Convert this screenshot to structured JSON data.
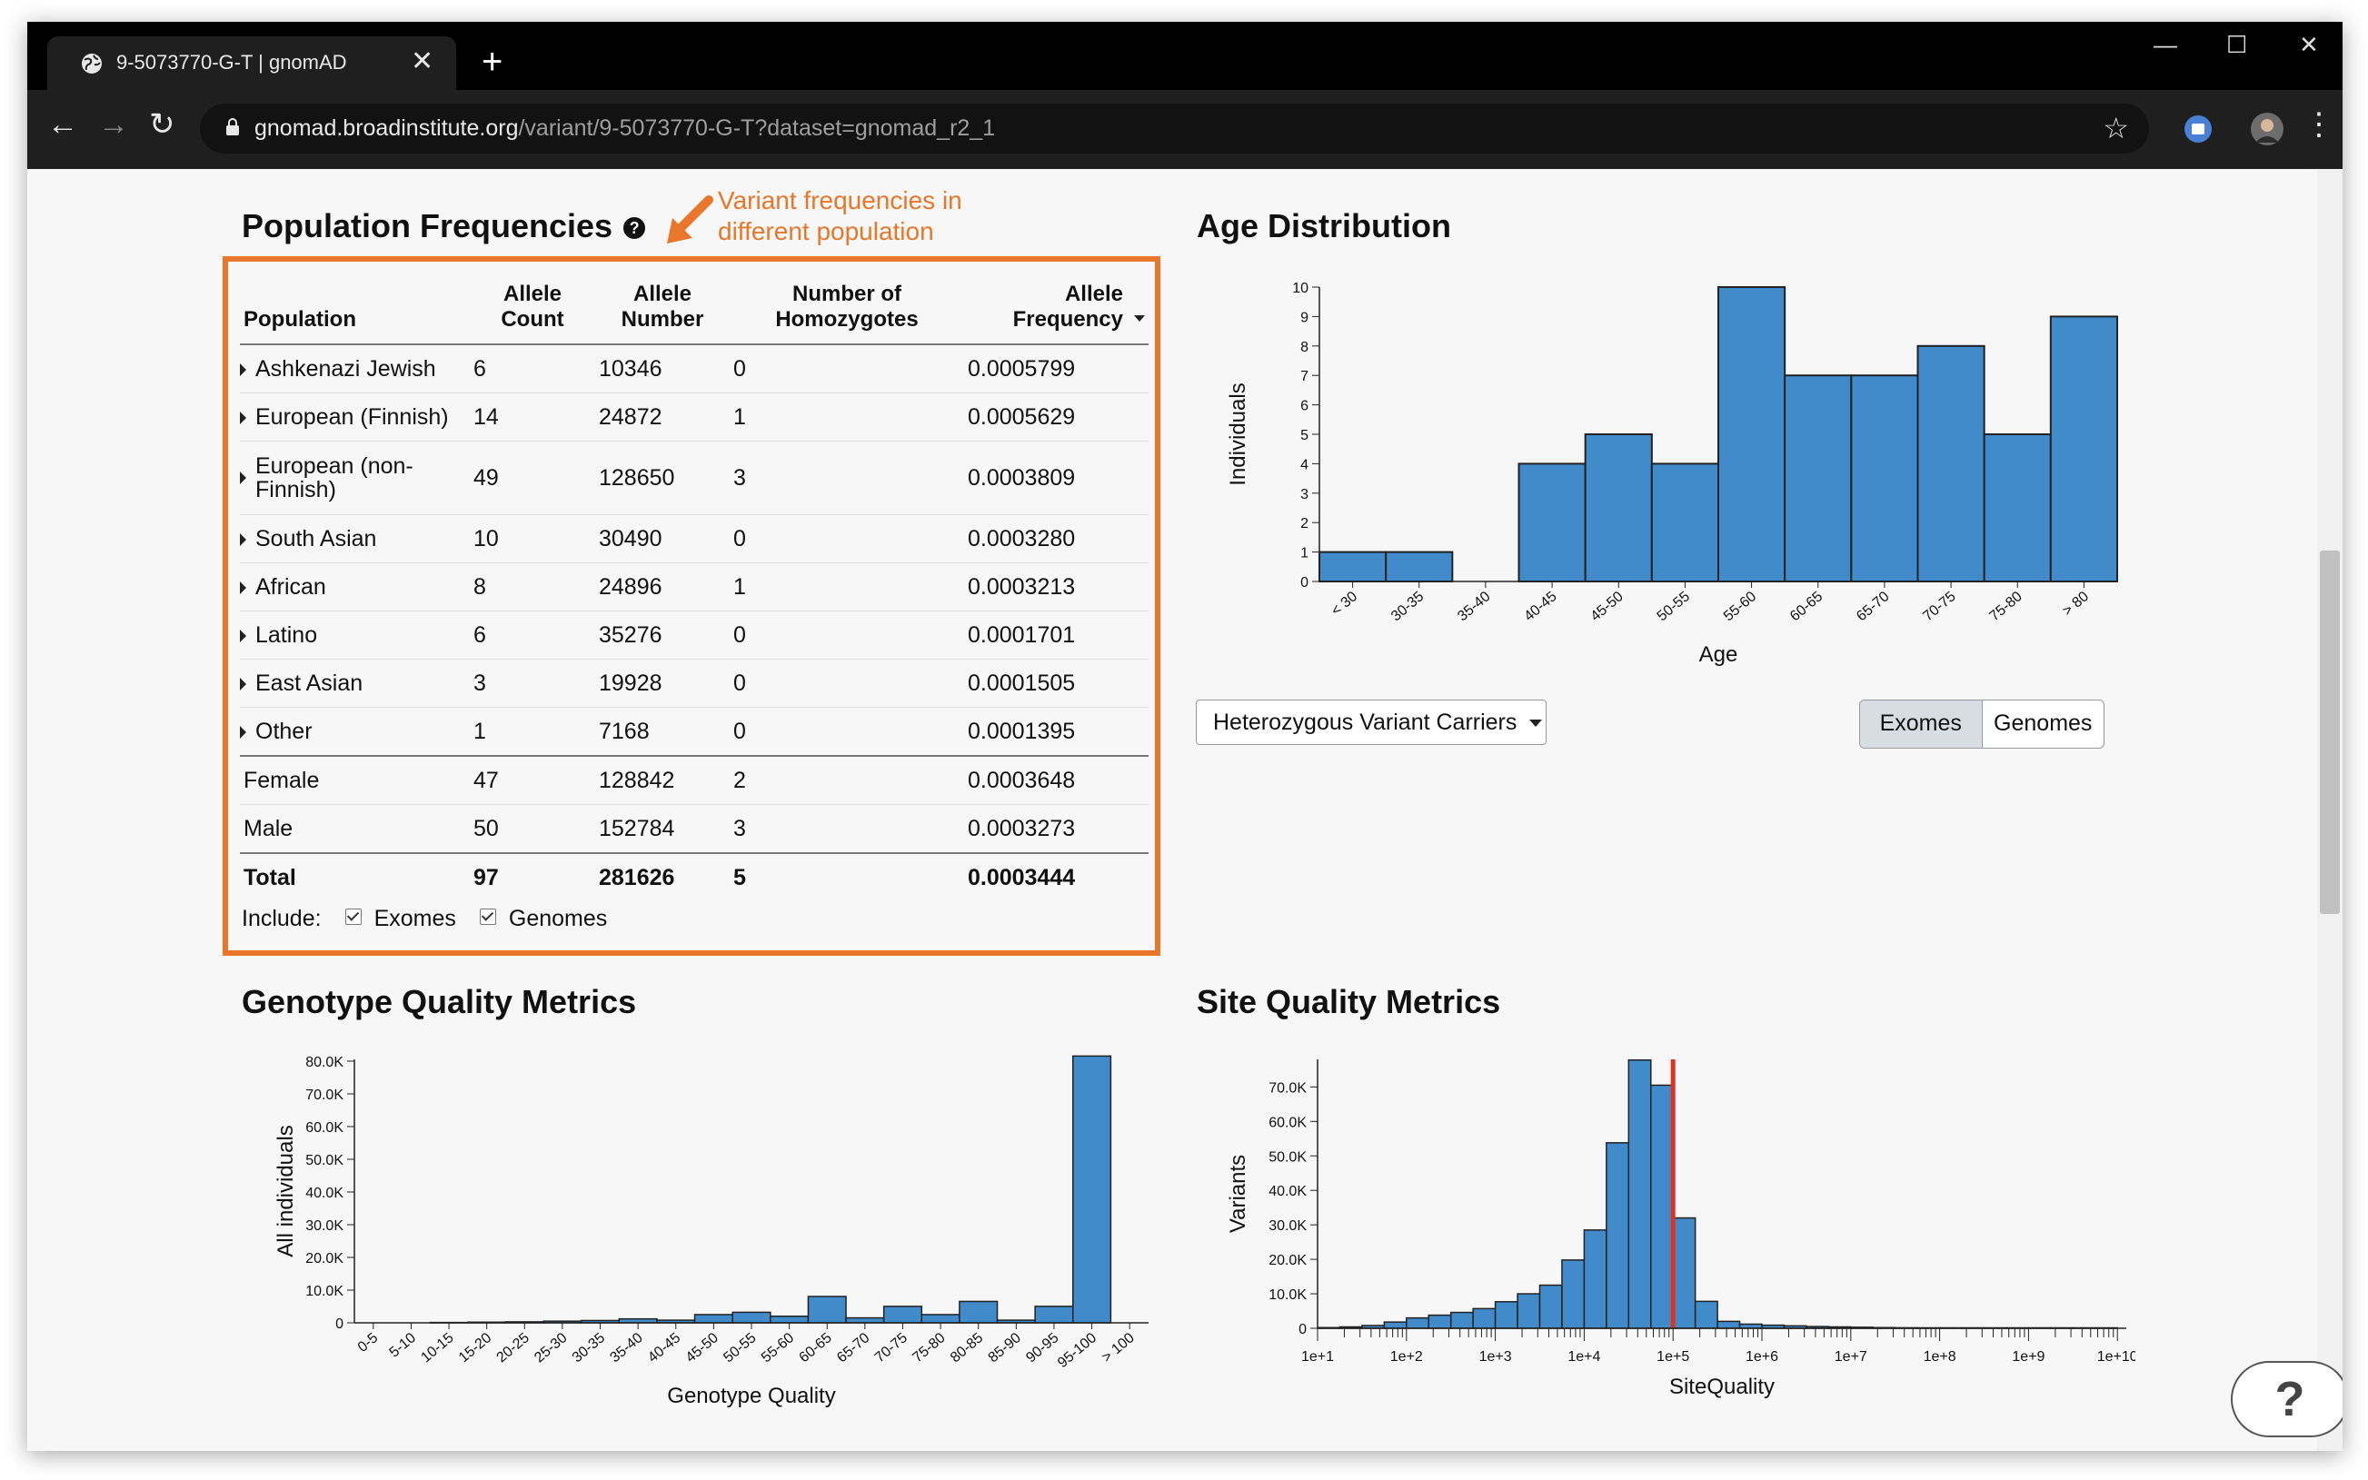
{
  "browser": {
    "tab_title": "9-5073770-G-T | gnomAD",
    "tab_close": "✕",
    "new_tab": "+",
    "url_host": "gnomad.broadinstitute.org",
    "url_path": "/variant/9-5073770-G-T?dataset=gnomad_r2_1",
    "window_controls": {
      "minimize": "—",
      "maximize": "☐",
      "close": "✕"
    },
    "nav": {
      "back": "←",
      "forward": "→",
      "reload": "↻",
      "menu": "⋮"
    }
  },
  "annotation": {
    "line1": "Variant frequencies in",
    "line2": "different population",
    "color": "#e8772b"
  },
  "population": {
    "title": "Population Frequencies",
    "help_icon": "?",
    "headers": {
      "population": "Population",
      "allele_count_1": "Allele",
      "allele_count_2": "Count",
      "allele_number_1": "Allele",
      "allele_number_2": "Number",
      "homozygotes_1": "Number of",
      "homozygotes_2": "Homozygotes",
      "frequency_1": "Allele",
      "frequency_2": "Frequency"
    },
    "rows": [
      {
        "name": "Ashkenazi Jewish",
        "ac": "6",
        "an": "10346",
        "hom": "0",
        "af": "0.0005799"
      },
      {
        "name": "European (Finnish)",
        "ac": "14",
        "an": "24872",
        "hom": "1",
        "af": "0.0005629"
      },
      {
        "name": "European (non-Finnish)",
        "ac": "49",
        "an": "128650",
        "hom": "3",
        "af": "0.0003809"
      },
      {
        "name": "South Asian",
        "ac": "10",
        "an": "30490",
        "hom": "0",
        "af": "0.0003280"
      },
      {
        "name": "African",
        "ac": "8",
        "an": "24896",
        "hom": "1",
        "af": "0.0003213"
      },
      {
        "name": "Latino",
        "ac": "6",
        "an": "35276",
        "hom": "0",
        "af": "0.0001701"
      },
      {
        "name": "East Asian",
        "ac": "3",
        "an": "19928",
        "hom": "0",
        "af": "0.0001505"
      },
      {
        "name": "Other",
        "ac": "1",
        "an": "7168",
        "hom": "0",
        "af": "0.0001395"
      }
    ],
    "sex_rows": [
      {
        "name": "Female",
        "ac": "47",
        "an": "128842",
        "hom": "2",
        "af": "0.0003648"
      },
      {
        "name": "Male",
        "ac": "50",
        "an": "152784",
        "hom": "3",
        "af": "0.0003273"
      }
    ],
    "total": {
      "name": "Total",
      "ac": "97",
      "an": "281626",
      "hom": "5",
      "af": "0.0003444"
    },
    "include": {
      "label": "Include:",
      "exomes": "Exomes",
      "genomes": "Genomes",
      "exomes_checked": true,
      "genomes_checked": true
    }
  },
  "age": {
    "title": "Age Distribution",
    "dropdown": "Heterozygous Variant Carriers",
    "toggle": [
      "Exomes",
      "Genomes"
    ],
    "toggle_active": "Exomes"
  },
  "genotype_quality": {
    "title": "Genotype Quality Metrics"
  },
  "site_quality": {
    "title": "Site Quality Metrics"
  },
  "help_button": "?",
  "chart_data": [
    {
      "type": "bar",
      "categories": [
        "< 30",
        "30-35",
        "35-40",
        "40-45",
        "45-50",
        "50-55",
        "55-60",
        "60-65",
        "65-70",
        "70-75",
        "75-80",
        "> 80"
      ],
      "values": [
        1,
        1,
        0,
        4,
        5,
        4,
        10,
        7,
        7,
        8,
        5,
        9
      ],
      "xlabel": "Age",
      "ylabel": "Individuals",
      "ylim": [
        0,
        10
      ],
      "yticks": [
        0,
        1,
        2,
        3,
        4,
        5,
        6,
        7,
        8,
        9,
        10
      ],
      "color": "#428bca"
    },
    {
      "type": "bar",
      "categories": [
        "0-5",
        "5-10",
        "10-15",
        "15-20",
        "20-25",
        "25-30",
        "30-35",
        "35-40",
        "40-45",
        "45-50",
        "50-55",
        "55-60",
        "60-65",
        "65-70",
        "70-75",
        "75-80",
        "80-85",
        "85-90",
        "90-95",
        "95-100",
        "> 100"
      ],
      "values": [
        0,
        0,
        100,
        200,
        300,
        500,
        700,
        1200,
        800,
        2500,
        3200,
        2000,
        8000,
        1500,
        5000,
        2500,
        6500,
        800,
        5000,
        81000,
        0
      ],
      "xlabel": "Genotype Quality",
      "ylabel": "All individuals",
      "ylim": [
        0,
        80000
      ],
      "yticks": [
        "0",
        "10.0K",
        "20.0K",
        "30.0K",
        "40.0K",
        "50.0K",
        "60.0K",
        "70.0K",
        "80.0K"
      ],
      "color": "#428bca"
    },
    {
      "type": "bar",
      "log_x": true,
      "bin_edges_log10": [
        1.0,
        1.25,
        1.5,
        1.75,
        2.0,
        2.25,
        2.5,
        2.75,
        3.0,
        3.25,
        3.5,
        3.75,
        4.0,
        4.25,
        4.5,
        4.75,
        5.0,
        5.25,
        5.5,
        5.75,
        6.0,
        6.25,
        6.5,
        6.75,
        7.0,
        7.25,
        7.5,
        7.75,
        8.0,
        8.25,
        8.5,
        8.75,
        9.0,
        9.25,
        9.5,
        9.75,
        10.0
      ],
      "values": [
        200,
        400,
        800,
        1800,
        3000,
        3800,
        4600,
        5700,
        7700,
        10000,
        12500,
        19800,
        28500,
        53800,
        77800,
        70500,
        32000,
        7800,
        2000,
        1200,
        900,
        700,
        500,
        400,
        300,
        200,
        150,
        100,
        80,
        60,
        50,
        30,
        20,
        15,
        10,
        5
      ],
      "xticks": [
        "1e+1",
        "1e+2",
        "1e+3",
        "1e+4",
        "1e+5",
        "1e+6",
        "1e+7",
        "1e+8",
        "1e+9",
        "1e+10"
      ],
      "xlabel": "SiteQuality",
      "ylabel": "Variants",
      "ylim": [
        0,
        78000
      ],
      "yticks": [
        "0",
        "10.0K",
        "20.0K",
        "30.0K",
        "40.0K",
        "50.0K",
        "60.0K",
        "70.0K"
      ],
      "variant_marker_log10": 5.0,
      "marker_color": "#dd3322",
      "color": "#428bca"
    }
  ]
}
